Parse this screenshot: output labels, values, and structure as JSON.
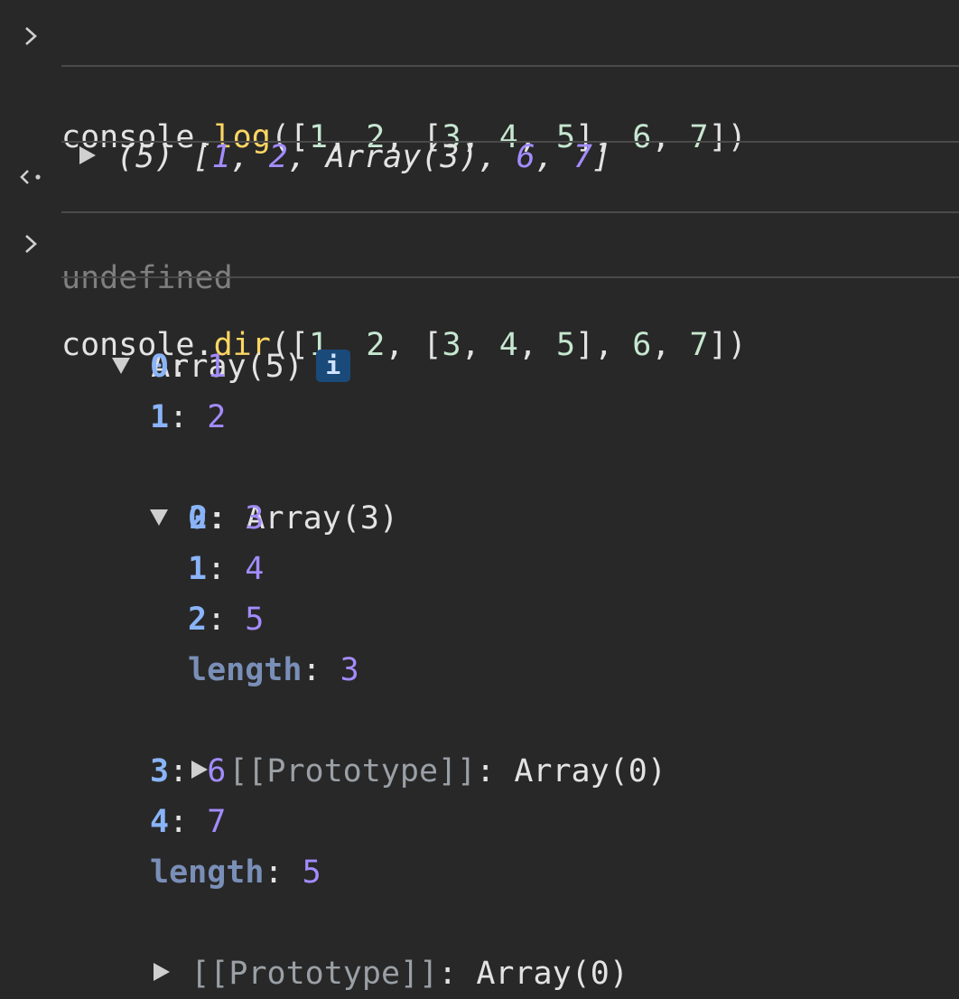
{
  "log_command": {
    "object": "console",
    "dot": ".",
    "method": "log",
    "args_open": "([",
    "args_body_pre": "1, 2, [3, 4, 5], 6, 7",
    "args_close": "])"
  },
  "log_output": {
    "count": "(5) ",
    "open": "[",
    "v1": "1",
    "v2": "2",
    "nested": "Array(3)",
    "v4": "6",
    "v5": "7",
    "close": "]",
    "comma": ", "
  },
  "return_value": "undefined",
  "dir_command": {
    "object": "console",
    "dot": ".",
    "method": "dir",
    "args_open": "([",
    "args_close": "])"
  },
  "tree": {
    "root_label": "Array(5)",
    "info_badge": "i",
    "items": [
      {
        "key": "0",
        "value": "1"
      },
      {
        "key": "1",
        "value": "2"
      },
      {
        "key": "2",
        "value": "Array(3)"
      },
      {
        "key": "3",
        "value": "6"
      },
      {
        "key": "4",
        "value": "7"
      }
    ],
    "nested_items": [
      {
        "key": "0",
        "value": "3"
      },
      {
        "key": "1",
        "value": "4"
      },
      {
        "key": "2",
        "value": "5"
      }
    ],
    "nested_length_key": "length",
    "nested_length_value": "3",
    "nested_proto_key": "[[Prototype]]",
    "nested_proto_value": "Array(0)",
    "length_key": "length",
    "length_value": "5",
    "proto_key": "[[Prototype]]",
    "proto_value": "Array(0)",
    "colon": ": "
  },
  "colors": {
    "background": "#282828",
    "function": "#fdd663",
    "number": "#a38cff",
    "key": "#8ab4f8"
  }
}
